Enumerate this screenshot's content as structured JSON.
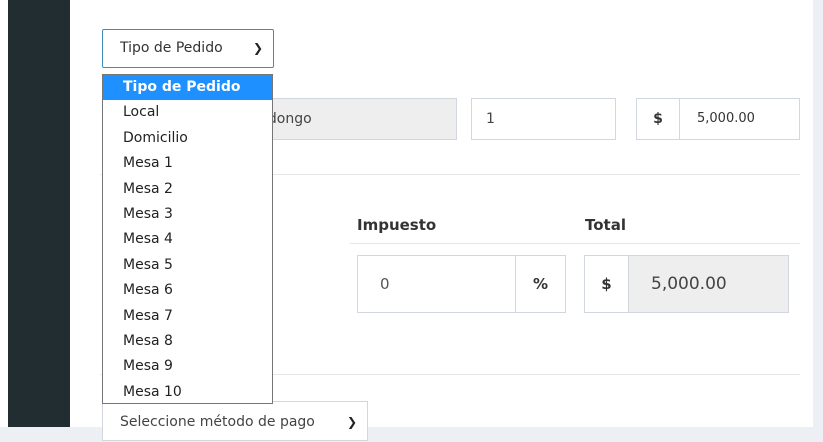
{
  "order_type": {
    "selected_label": "Tipo de Pedido",
    "options": [
      "Tipo de Pedido",
      "Local",
      "Domicilio",
      "Mesa 1",
      "Mesa 2",
      "Mesa 3",
      "Mesa 4",
      "Mesa 5",
      "Mesa 6",
      "Mesa 7",
      "Mesa 8",
      "Mesa 9",
      "Mesa 10"
    ],
    "highlighted_index": 0
  },
  "item_row": {
    "product_partial": "ndongo",
    "quantity": "1",
    "currency_symbol": "$",
    "price": "5,000.00"
  },
  "totals": {
    "tax_label": "Impuesto",
    "total_label": "Total",
    "tax_value": "0",
    "percent_symbol": "%",
    "currency_symbol": "$",
    "total_value": "5,000.00"
  },
  "payment": {
    "placeholder": "Seleccione método de pago"
  },
  "icons": {
    "dropdown_chevron": "chevron-down-icon"
  },
  "colors": {
    "sidebar": "#222d32",
    "focus_border": "#3c8dbc",
    "selected_option": "#1e90ff",
    "readonly_bg": "#eeeeee"
  }
}
